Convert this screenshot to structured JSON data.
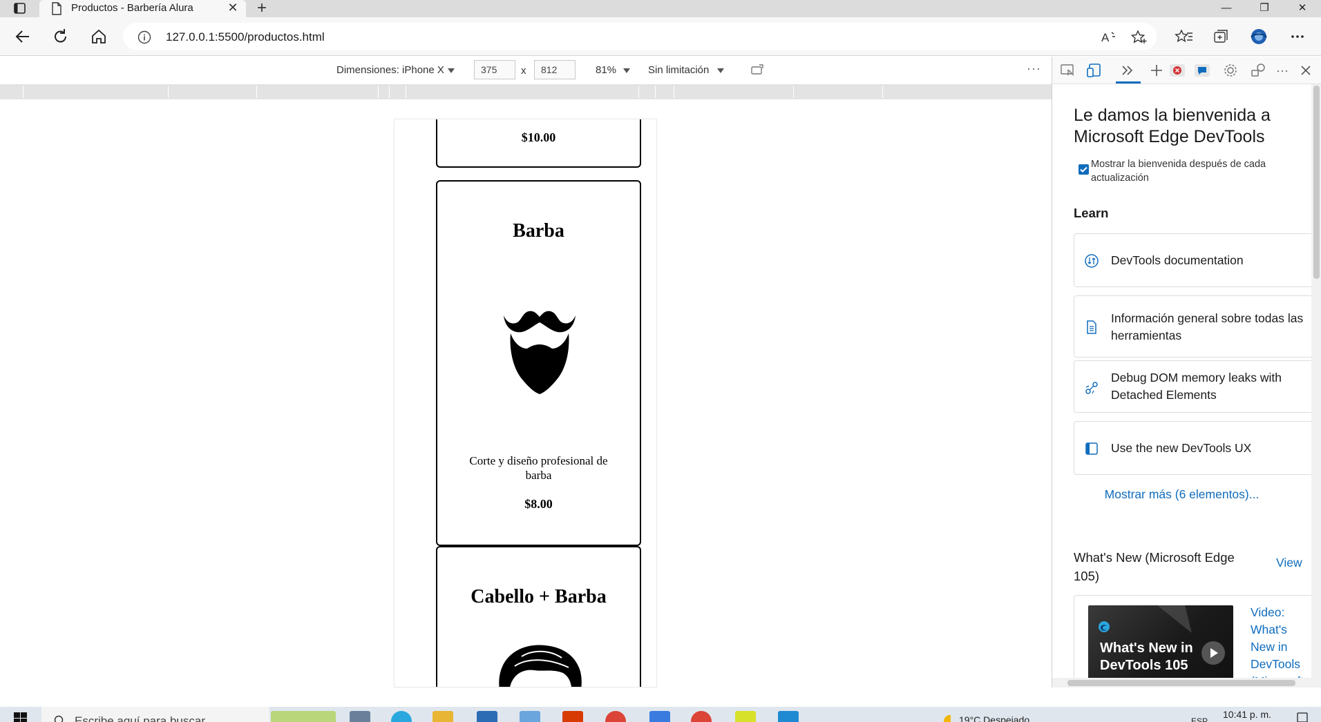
{
  "browser": {
    "tab_title": "Productos - Barbería Alura",
    "url": "127.0.0.1:5500/productos.html"
  },
  "device_toolbar": {
    "dimensions_label": "Dimensiones: iPhone X",
    "width": "375",
    "height": "812",
    "times": "x",
    "zoom": "81%",
    "throttle": "Sin limitación"
  },
  "page": {
    "cards": [
      {
        "price": "$10.00"
      },
      {
        "title": "Barba",
        "description": "Corte y diseño profesional de barba",
        "price": "$8.00",
        "icon": "beard-icon"
      },
      {
        "title": "Cabello + Barba",
        "icon": "hair-icon"
      }
    ]
  },
  "devtools": {
    "welcome_title": "Le damos la bienvenida a Microsoft Edge DevTools",
    "welcome_checkbox_label": "Mostrar la bienvenida después de cada actualización",
    "welcome_checkbox_checked": true,
    "learn_title": "Learn",
    "learn_items": [
      {
        "label": "DevTools documentation",
        "icon": "documentation-icon"
      },
      {
        "label": "Información general sobre todas las herramientas",
        "icon": "document-icon"
      },
      {
        "label": "Debug DOM memory leaks with Detached Elements",
        "icon": "dom-leak-icon"
      },
      {
        "label": "Use the new DevTools UX",
        "icon": "panel-icon"
      }
    ],
    "show_more": "Mostrar más (6 elementos)...",
    "whats_new_title": "What's New (Microsoft Edge 105)",
    "whats_new_view": "View",
    "video_thumb_text": "What's New in DevTools 105",
    "video_link": "Video: What's New in DevTools (Microsoft"
  },
  "taskbar": {
    "search_placeholder": "Escribe aquí para buscar",
    "temperature": "19°C  Despejado",
    "language": "ESP",
    "time": "10:41 p. m."
  },
  "colors": {
    "accent": "#0f6cbd",
    "tabstrip": "#dcdcdc",
    "ruler": "#e3e3e3"
  }
}
